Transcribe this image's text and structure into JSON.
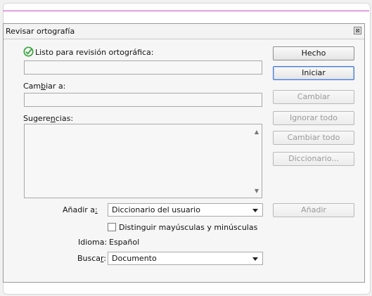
{
  "dialog": {
    "title": "Revisar ortografía",
    "close_icon": "close-icon"
  },
  "status": {
    "icon": "checkmark-circle-icon",
    "text": "Listo para revisión ortográfica:",
    "word_value": ""
  },
  "change_to": {
    "label_pre": "Cam",
    "label_u": "b",
    "label_post": "iar a:",
    "value": ""
  },
  "suggestions": {
    "label_pre": "Sugere",
    "label_u": "n",
    "label_post": "cias:",
    "items": []
  },
  "buttons": {
    "done": "Hecho",
    "start": "Iniciar",
    "change": "Cambiar",
    "ignore_all": "Ignorar todo",
    "change_all": "Cambiar todo",
    "dictionary": "Diccionario...",
    "add": "Añadir"
  },
  "add_to": {
    "label_pre": "Añadir a",
    "label_u": ":",
    "value": "Diccionario del usuario"
  },
  "case_sensitive": {
    "label": "Distinguir mayúsculas y minúsculas",
    "checked": false
  },
  "language": {
    "label": "Idioma:",
    "value": "Español"
  },
  "search": {
    "label_pre": "Busca",
    "label_u": "r",
    "label_post": ":",
    "value": "Documento"
  },
  "colors": {
    "accent_line": "#c64ec6",
    "check_icon": "#3aa33a",
    "primary_border": "#4a7ad0"
  }
}
